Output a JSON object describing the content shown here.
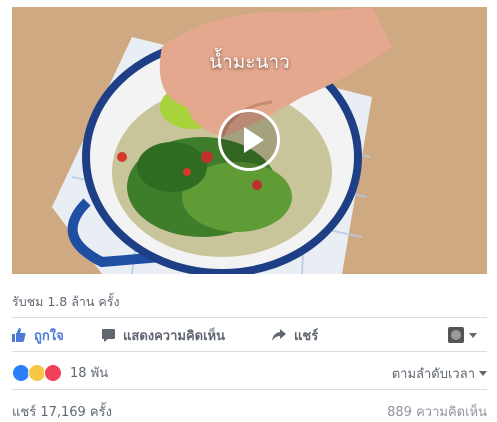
{
  "video": {
    "caption": "น้ำมะนาว",
    "play_icon": "play-icon"
  },
  "views_text": "รับชม 1.8 ล้าน ครั้ง",
  "actions": {
    "like_label": "ถูกใจ",
    "comment_label": "แสดงความคิดเห็น",
    "share_label": "แชร์"
  },
  "reactions": {
    "icons": [
      "like-icon",
      "wow-icon",
      "love-icon"
    ],
    "count": "18 พัน"
  },
  "sort_label": "ตามลำดับเวลา",
  "shares_text": "แชร์ 17,169 ครั้ง",
  "comments_text": "889 ความคิดเห็น",
  "colors": {
    "like_blue": "#2d7ff9",
    "wow_yellow": "#f7c843",
    "love_red": "#f2405c",
    "muted_text": "#606770"
  }
}
